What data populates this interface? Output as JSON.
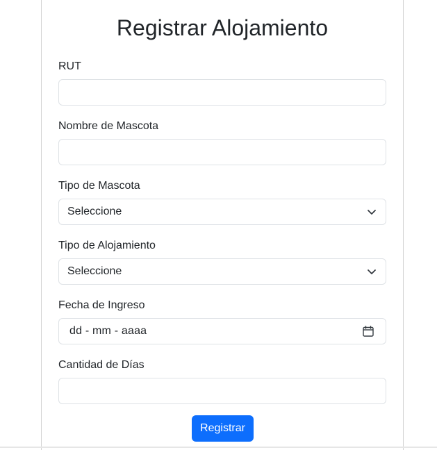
{
  "form": {
    "title": "Registrar Alojamiento",
    "fields": {
      "rut": {
        "label": "RUT",
        "value": ""
      },
      "pet_name": {
        "label": "Nombre de Mascota",
        "value": ""
      },
      "pet_type": {
        "label": "Tipo de Mascota",
        "selected": "Seleccione"
      },
      "lodging_type": {
        "label": "Tipo de Alojamiento",
        "selected": "Seleccione"
      },
      "entry_date": {
        "label": "Fecha de Ingreso",
        "placeholder": "dd - mm - aaaa"
      },
      "days": {
        "label": "Cantidad de Días",
        "value": ""
      }
    },
    "submit_label": "Registrar"
  },
  "icons": {
    "select_arrow": "chevron-down-icon",
    "date_picker": "calendar-icon"
  },
  "colors": {
    "primary": "#0d6efd",
    "border": "#dee2e6",
    "text": "#212529"
  }
}
